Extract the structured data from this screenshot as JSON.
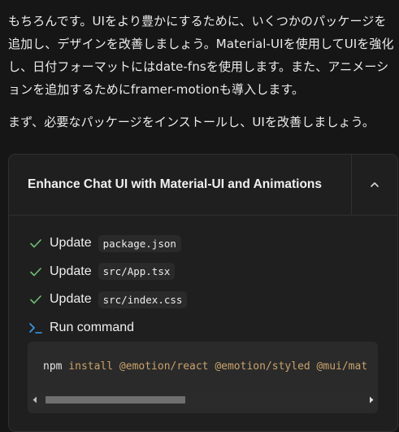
{
  "message": {
    "paragraph1": "もちろんです。UIをより豊かにするために、いくつかのパッケージを追加し、デザインを改善しましょう。Material-UIを使用してUIを強化し、日付フォーマットにはdate-fnsを使用します。また、アニメーションを追加するためにframer-motionも導入します。",
    "paragraph2": "まず、必要なパッケージをインストールし、UIを改善しましょう。"
  },
  "card": {
    "title": "Enhance Chat UI with Material-UI and Animations",
    "collapse_icon": "chevron-up-icon",
    "steps": [
      {
        "label": "Update",
        "file": "package.json",
        "icon": "check-icon"
      },
      {
        "label": "Update",
        "file": "src/App.tsx",
        "icon": "check-icon"
      },
      {
        "label": "Update",
        "file": "src/index.css",
        "icon": "check-icon"
      },
      {
        "label": "Run command",
        "icon": "terminal-icon"
      }
    ],
    "command": {
      "cmd": "npm",
      "args": " install @emotion/react @emotion/styled @mui/mat"
    }
  },
  "colors": {
    "check": "#6fbf73",
    "terminal": "#3b9be8",
    "code_args": "#c9a36c"
  }
}
